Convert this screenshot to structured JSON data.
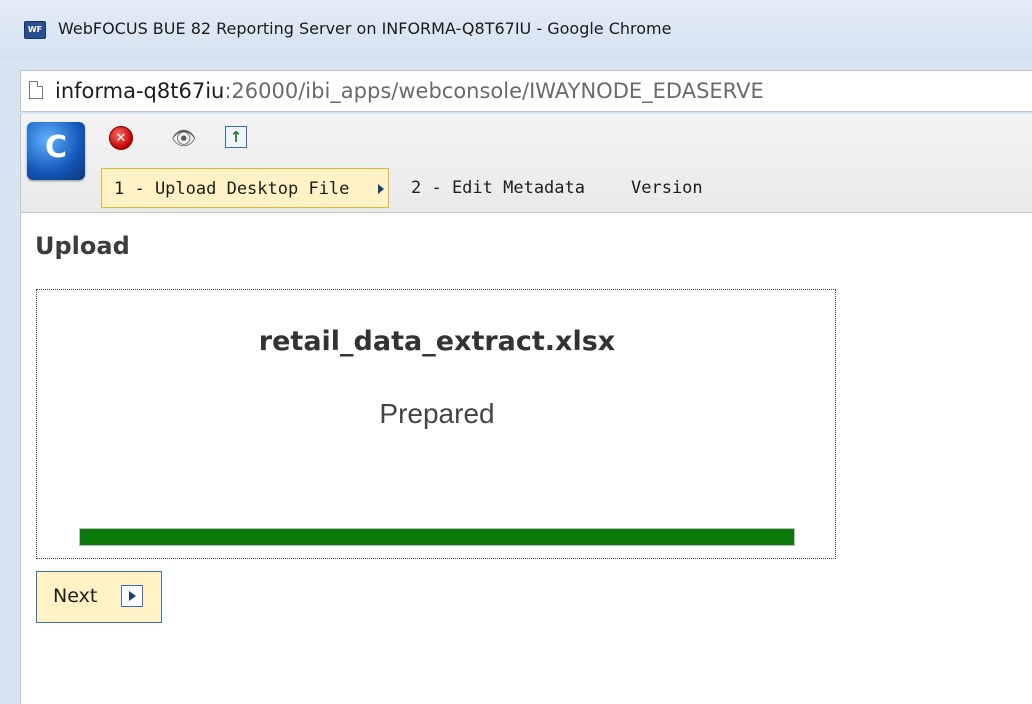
{
  "window": {
    "title": "WebFOCUS BUE 82 Reporting Server on INFORMA-Q8T67IU - Google Chrome",
    "icon_label": "WF"
  },
  "address_bar": {
    "host": "informa-q8t67iu",
    "rest": ":26000/ibi_apps/webconsole/IWAYNODE_EDASERVE"
  },
  "toolbar": {
    "logo_label": "C",
    "icons": [
      "close-icon",
      "preview-icon",
      "upload-icon"
    ]
  },
  "tabs": [
    {
      "label": "1 - Upload Desktop File",
      "active": true
    },
    {
      "label": "2 - Edit Metadata",
      "active": false
    },
    {
      "label": "Version",
      "active": false
    }
  ],
  "main": {
    "section_title": "Upload",
    "filename": "retail_data_extract.xlsx",
    "status": "Prepared",
    "progress_percent": 100
  },
  "buttons": {
    "next_label": "Next"
  },
  "colors": {
    "progress": "#0b7a0b",
    "active_tab": "#fff2c4",
    "active_tab_border": "#e5b53d"
  }
}
